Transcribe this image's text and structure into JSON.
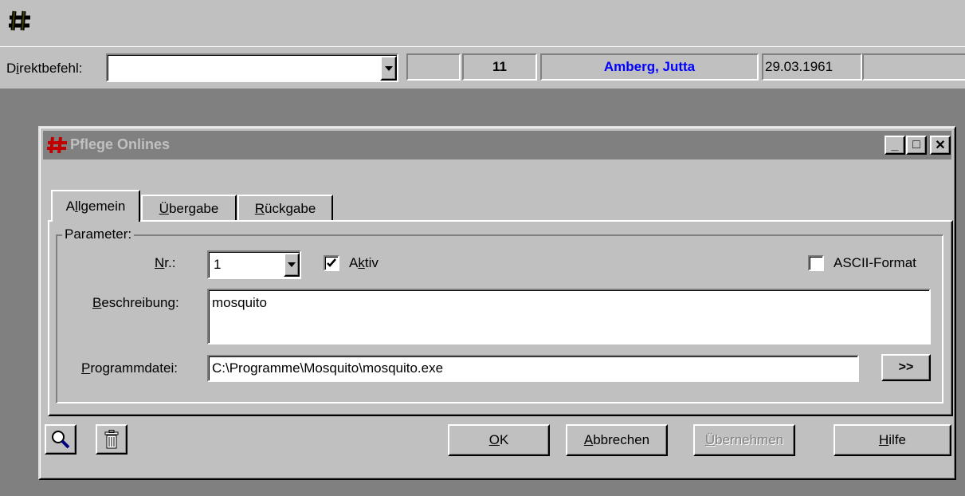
{
  "toolbar": {
    "app_icon": "hash-icon"
  },
  "command_bar": {
    "label_prefix": "D",
    "label_accel": "i",
    "label_suffix": "rektbefehl:",
    "value": "",
    "status1": "",
    "status_number": "11",
    "patient_name": "Amberg, Jutta",
    "patient_dob": "29.03.1961",
    "status_last": ""
  },
  "dialog": {
    "title": "Pflege Onlines",
    "title_icon": "hash-icon",
    "buttons": {
      "minimize": "_",
      "maximize": "□",
      "close": "✕"
    },
    "tabs": [
      {
        "pre": "A",
        "accel": "l",
        "post": "lgemein",
        "active": true
      },
      {
        "pre": "",
        "accel": "Ü",
        "post": "bergabe",
        "active": false
      },
      {
        "pre": "",
        "accel": "R",
        "post": "ückgabe",
        "active": false
      }
    ],
    "group_label": "Parameter:",
    "nr": {
      "label_accel": "N",
      "label_rest": "r.:",
      "value": "1"
    },
    "aktiv": {
      "label_pre": "A",
      "label_accel": "k",
      "label_post": "tiv",
      "checked": true
    },
    "ascii": {
      "label": "ASCII-Format",
      "checked": false
    },
    "beschreibung": {
      "label_accel": "B",
      "label_rest": "eschreibung:",
      "value": "mosquito"
    },
    "programmdatei": {
      "label_accel": "P",
      "label_rest": "rogrammdatei:",
      "value": "C:\\Programme\\Mosquito\\mosquito.exe",
      "browse": ">>"
    },
    "footer": {
      "search_icon": "magnifier-icon",
      "delete_icon": "trash-icon",
      "ok": {
        "accel": "O",
        "rest": "K"
      },
      "cancel": {
        "accel": "A",
        "rest": "bbrechen"
      },
      "apply": {
        "accel": "Ü",
        "rest": "bernehmen",
        "disabled": true
      },
      "help": {
        "accel": "H",
        "rest": "ilfe"
      }
    }
  },
  "colors": {
    "desktop": "#808080",
    "face": "#c0c0c0",
    "title_inactive": "#808080",
    "title_text": "#c0c0c0",
    "patient_name": "#0000ff",
    "icon_red": "#c00000"
  }
}
